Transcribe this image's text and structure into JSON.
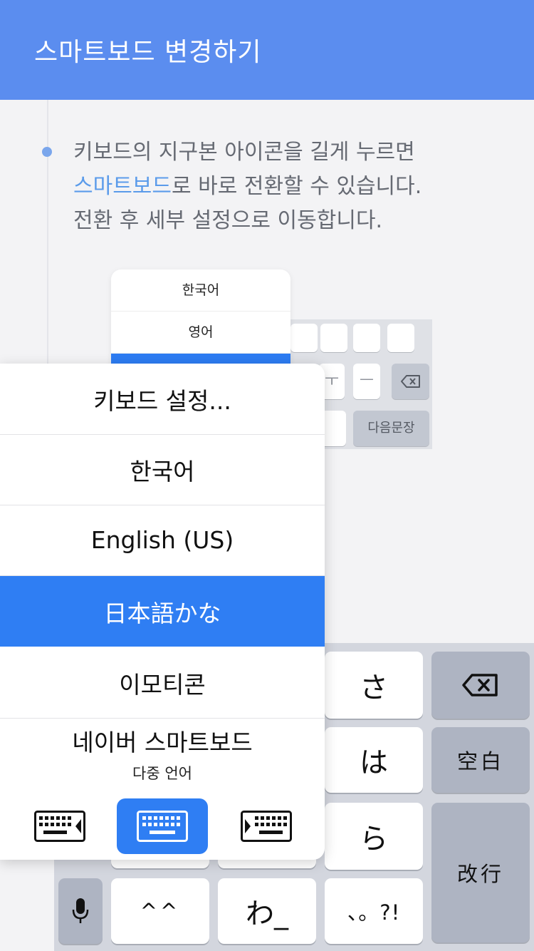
{
  "header": {
    "title": "스마트보드 변경하기"
  },
  "description": {
    "line1": "키보드의 지구본 아이콘을 길게 누르면",
    "line2_highlight": "스마트보드",
    "line2_rest": "로 바로 전환할 수 있습니다.",
    "line3": "전환 후 세부 설정으로 이동합니다."
  },
  "mini_popup": {
    "items": [
      "한국어",
      "영어"
    ]
  },
  "mini_keyboard": {
    "next_sentence": "다음문장"
  },
  "popup_menu": {
    "items": [
      {
        "label": "키보드 설정..."
      },
      {
        "label": "한국어"
      },
      {
        "label": "English (US)"
      },
      {
        "label": "日本語かな",
        "selected": true
      },
      {
        "label": "이모티콘"
      },
      {
        "label": "네이버 스마트보드",
        "sublabel": "다중 언어"
      }
    ]
  },
  "keyboard": {
    "keys": {
      "sa": "さ",
      "ha": "は",
      "ra": "ら",
      "emoticon": "^^",
      "wa": "わ_",
      "punct": "、。?!"
    },
    "space": "空白",
    "enter": "改行"
  },
  "colors": {
    "header": "#5b8def",
    "accent": "#2f7ef3",
    "highlight": "#5b9bea"
  }
}
